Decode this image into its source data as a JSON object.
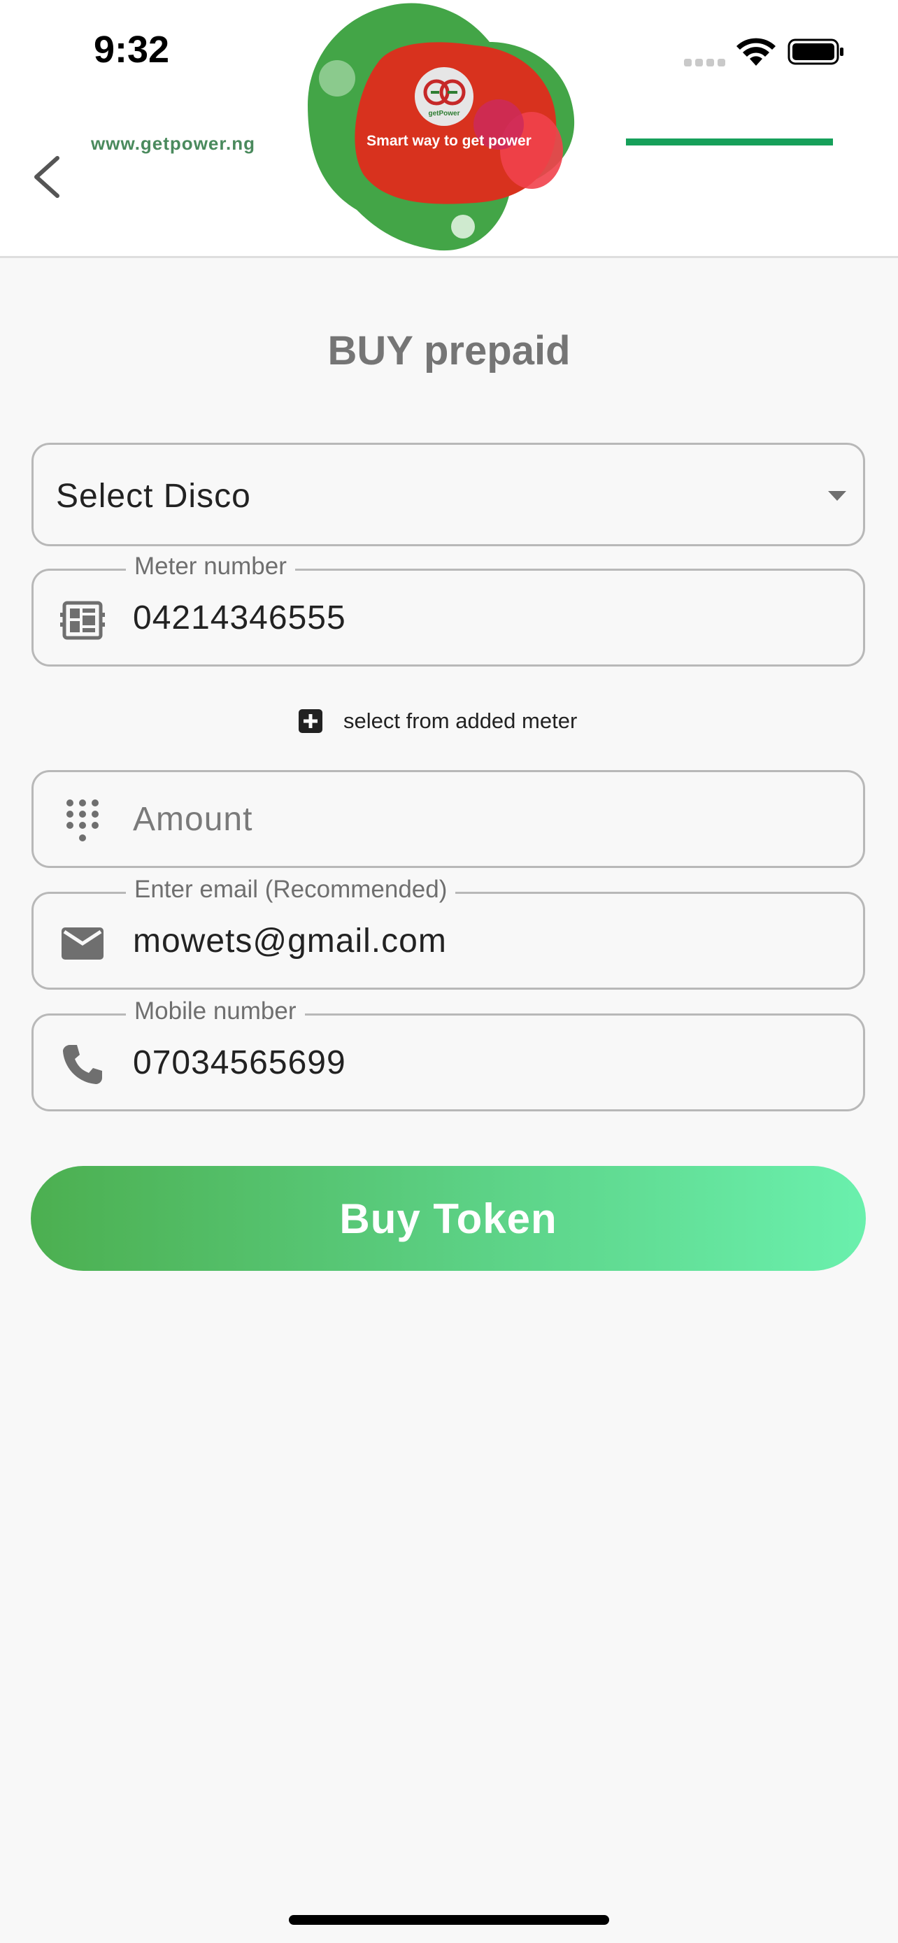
{
  "status_bar": {
    "time": "9:32"
  },
  "header": {
    "site_url": "www.getpower.ng",
    "logo_brand": "getPower",
    "logo_tagline": "Smart way to get power",
    "brand_colors": {
      "green": "#4caf50",
      "red": "#d32f2f",
      "accent_line": "#16a05a"
    }
  },
  "page": {
    "title": "BUY prepaid"
  },
  "form": {
    "disco": {
      "value": "Select Disco"
    },
    "meter": {
      "label": "Meter number",
      "value": "04214346555"
    },
    "add_meter_label": "select from added meter",
    "amount": {
      "placeholder": "Amount"
    },
    "email": {
      "label": "Enter email (Recommended)",
      "value": "mowets@gmail.com"
    },
    "mobile": {
      "label": "Mobile number",
      "value": "07034565699"
    }
  },
  "actions": {
    "buy_label": "Buy Token"
  },
  "icons": {
    "back": "chevron-left-icon",
    "meter": "meter-icon",
    "amount": "dialpad-icon",
    "email": "mail-icon",
    "mobile": "phone-icon",
    "add": "plus-box-icon",
    "dropdown": "caret-down-icon"
  }
}
